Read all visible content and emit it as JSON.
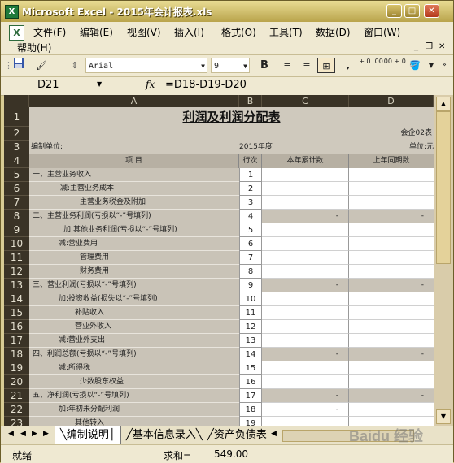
{
  "window": {
    "title": "Microsoft Excel - 2015年会计报表.xls"
  },
  "menu": {
    "file": "文件(F)",
    "edit": "编辑(E)",
    "view": "视图(V)",
    "insert": "插入(I)",
    "format": "格式(O)",
    "tools": "工具(T)",
    "data": "数据(D)",
    "window": "窗口(W)",
    "help": "帮助(H)"
  },
  "toolbar": {
    "font_name": "Arial",
    "font_size": "9",
    "bold": "B",
    "comma": ",",
    "increase_decimal": "+.0 .00",
    "decrease_decimal": ".00 +.0"
  },
  "formula_bar": {
    "name_box": "D21",
    "fx": "fx",
    "formula": "=D18-D19-D20"
  },
  "columns": [
    "A",
    "B",
    "C",
    "D"
  ],
  "sheet": {
    "title": "利润及利润分配表",
    "form_no": "会企02表",
    "unit_label": "编制单位:",
    "year": "2015年度",
    "currency_unit": "单位:元",
    "headers": {
      "item": "项          目",
      "line": "行次",
      "current": "本年累计数",
      "previous": "上年同期数"
    },
    "rows": [
      {
        "num": "5",
        "item": "一、主营业务收入",
        "line": "1",
        "current": "",
        "previous": ""
      },
      {
        "num": "6",
        "item": "减:主营业务成本",
        "line": "2",
        "current": "",
        "previous": ""
      },
      {
        "num": "7",
        "item": "主营业务税金及附加",
        "line": "3",
        "current": "",
        "previous": ""
      },
      {
        "num": "8",
        "item": "二、主营业务利润(亏损以“-”号填列)",
        "line": "4",
        "current": "-",
        "previous": "-"
      },
      {
        "num": "9",
        "item": "加:其他业务利润(亏损以“-”号填列)",
        "line": "5",
        "current": "",
        "previous": ""
      },
      {
        "num": "10",
        "item": "减:营业费用",
        "line": "6",
        "current": "",
        "previous": ""
      },
      {
        "num": "11",
        "item": "管理费用",
        "line": "7",
        "current": "",
        "previous": ""
      },
      {
        "num": "12",
        "item": "财务费用",
        "line": "8",
        "current": "",
        "previous": ""
      },
      {
        "num": "13",
        "item": "三、营业利润(亏损以“-”号填列)",
        "line": "9",
        "current": "-",
        "previous": "-"
      },
      {
        "num": "14",
        "item": "加:投资收益(损失以“-”号填列)",
        "line": "10",
        "current": "",
        "previous": ""
      },
      {
        "num": "15",
        "item": "补贴收入",
        "line": "11",
        "current": "",
        "previous": ""
      },
      {
        "num": "16",
        "item": "营业外收入",
        "line": "12",
        "current": "",
        "previous": ""
      },
      {
        "num": "17",
        "item": "减:营业外支出",
        "line": "13",
        "current": "",
        "previous": ""
      },
      {
        "num": "18",
        "item": "四、利润总额(亏损以“-”号填列)",
        "line": "14",
        "current": "-",
        "previous": "-"
      },
      {
        "num": "19",
        "item": "减:所得税",
        "line": "15",
        "current": "",
        "previous": ""
      },
      {
        "num": "20",
        "item": "少数股东权益",
        "line": "16",
        "current": "",
        "previous": ""
      },
      {
        "num": "21",
        "item": "五、净利润(亏损以“-”号填列)",
        "line": "17",
        "current": "-",
        "previous": "-"
      },
      {
        "num": "22",
        "item": "加:年初未分配利润",
        "line": "18",
        "current": "-",
        "previous": ""
      },
      {
        "num": "23",
        "item": "其他转入",
        "line": "19",
        "current": "",
        "previous": ""
      }
    ]
  },
  "tabs": {
    "tab1": "编制说明",
    "tab2": "基本信息录入",
    "tab3": "资产负债表"
  },
  "status": {
    "ready": "就绪",
    "sum_label": "求和=",
    "sum_value": "549.00"
  },
  "watermark": "Baidu 经验"
}
